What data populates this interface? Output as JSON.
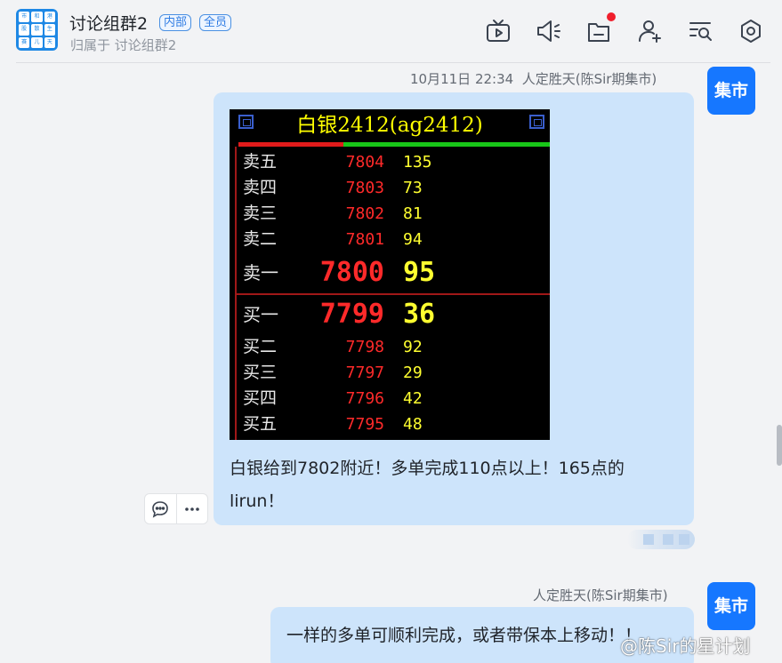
{
  "header": {
    "avatar_chars": [
      "市",
      "和",
      "港",
      "股",
      "散",
      "生",
      "赛",
      "儿",
      "天"
    ],
    "title": "讨论组群2",
    "tags": [
      "内部",
      "全员"
    ],
    "subtitle": "归属于 讨论组群2",
    "icons": [
      "tv-icon",
      "megaphone-icon",
      "folder-icon",
      "add-member-icon",
      "search-list-icon",
      "settings-icon"
    ],
    "notification_dot_color": "#f01e2c"
  },
  "messages": [
    {
      "time": "10月11日 22:34",
      "sender": "人定胜天(陈Sir期集市)",
      "avatar_label": "集市",
      "image": {
        "title": "白银2412(ag2412)",
        "sell_rows": [
          {
            "label": "卖五",
            "price": "7804",
            "volume": "135"
          },
          {
            "label": "卖四",
            "price": "7803",
            "volume": "73"
          },
          {
            "label": "卖三",
            "price": "7802",
            "volume": "81"
          },
          {
            "label": "卖二",
            "price": "7801",
            "volume": "94"
          },
          {
            "label": "卖一",
            "price": "7800",
            "volume": "95"
          }
        ],
        "buy_rows": [
          {
            "label": "买一",
            "price": "7799",
            "volume": "36"
          },
          {
            "label": "买二",
            "price": "7798",
            "volume": "92"
          },
          {
            "label": "买三",
            "price": "7797",
            "volume": "29"
          },
          {
            "label": "买四",
            "price": "7796",
            "volume": "42"
          },
          {
            "label": "买五",
            "price": "7795",
            "volume": "48"
          }
        ]
      },
      "text_line1": "白银给到7802附近！多单完成110点以上！165点的",
      "text_line2": "lirun！"
    },
    {
      "sender": "人定胜天(陈Sir期集市)",
      "avatar_label": "集市",
      "text": "一样的多单可顺利完成，或者带保本上移动！！"
    }
  ],
  "hover_actions": [
    "reply-icon",
    "more-icon"
  ],
  "watermark": "@陈Sir的星计划",
  "colors": {
    "bubble": "#cde4fb",
    "avatar": "#1677ff",
    "background": "#f2f3f5"
  }
}
